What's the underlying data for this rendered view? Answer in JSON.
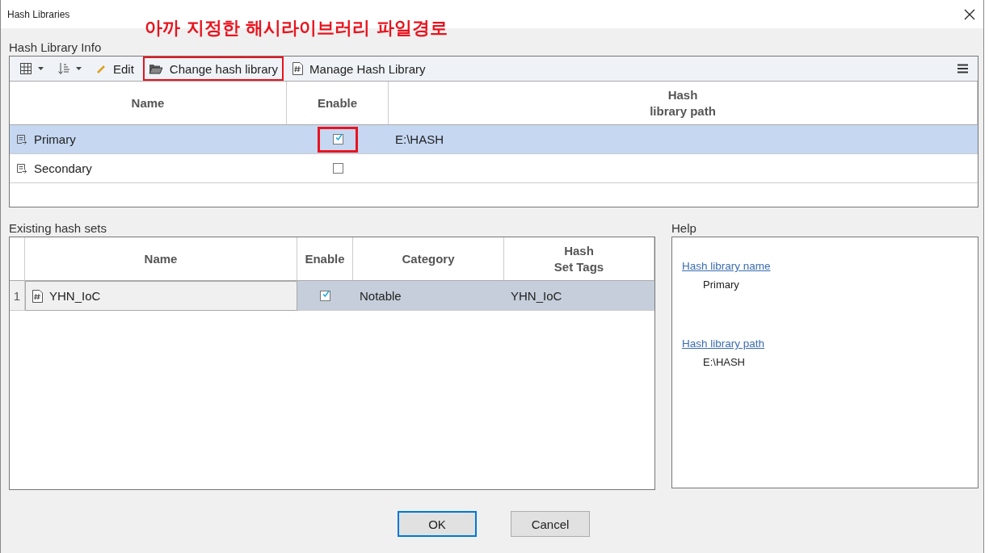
{
  "window": {
    "title": "Hash Libraries"
  },
  "annotation": {
    "text": "아까 지정한 해시라이브러리 파일경로"
  },
  "library_info": {
    "label": "Hash Library Info",
    "toolbar": [
      {
        "kind": "grid",
        "highlighted": false
      },
      {
        "kind": "sort",
        "highlighted": false
      },
      {
        "kind": "edit",
        "label": "Edit",
        "highlighted": false
      },
      {
        "kind": "folder",
        "label": "Change hash library",
        "highlighted": true
      },
      {
        "kind": "hash",
        "label": "Manage Hash Library",
        "highlighted": false
      }
    ],
    "columns": [
      "Name",
      "Enable",
      "Hash\nlibrary path"
    ],
    "rows": [
      {
        "name": "Primary",
        "enabled": true,
        "path": "E:\\HASH",
        "selected": true,
        "highlighted": true
      },
      {
        "name": "Secondary",
        "enabled": false,
        "selected": false,
        "highlighted": false
      }
    ]
  },
  "hash_sets": {
    "label": "Existing hash sets",
    "columns": [
      "Name",
      "Enable",
      "Category",
      "Hash\nSet Tags"
    ],
    "rows": [
      {
        "number": "1",
        "name": "YHN_IoC",
        "enabled": true,
        "category": "Notable",
        "tags": "YHN_IoC",
        "selected": true
      }
    ]
  },
  "help": {
    "label": "Help",
    "items": [
      {
        "link": "Hash library name",
        "value": "Primary"
      },
      {
        "link": "Hash library path",
        "value": "E:\\HASH"
      }
    ]
  },
  "buttons": [
    {
      "label": "OK",
      "default": true
    },
    {
      "label": "Cancel",
      "default": false
    }
  ]
}
